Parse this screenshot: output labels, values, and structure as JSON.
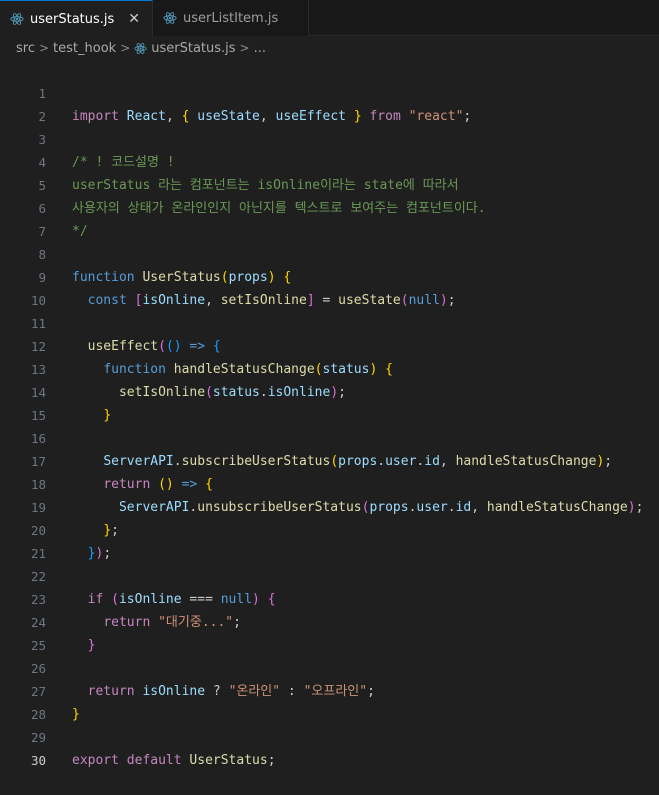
{
  "tabs": [
    {
      "label": "userStatus.js",
      "active": true
    },
    {
      "label": "userListItem.js",
      "active": false
    }
  ],
  "breadcrumb": {
    "items": [
      "src",
      "test_hook",
      "userStatus.js",
      "..."
    ]
  },
  "editor": {
    "line_numbers": [
      "1",
      "2",
      "3",
      "4",
      "5",
      "6",
      "7",
      "8",
      "9",
      "10",
      "11",
      "12",
      "13",
      "14",
      "15",
      "16",
      "17",
      "18",
      "19",
      "20",
      "21",
      "22",
      "23",
      "24",
      "25",
      "26",
      "27",
      "28",
      "29",
      "30"
    ],
    "comment_lines": [
      "/* ! 코드설명 !",
      "userStatus 라는 컴포넌트는 isOnline이라는 state에 따라서",
      "사용자의 상태가 온라인인지 아닌지를 텍스트로 보여주는 컴포넌트이다.",
      "*/"
    ],
    "strings": {
      "react": "\"react\"",
      "waiting": "\"대기중...\"",
      "online": "\"온라인\"",
      "offline": "\"오프라인\""
    }
  },
  "colors": {
    "background": "#1f1f1f",
    "tab_active_border": "#0078d4",
    "keyword": "#569cd6",
    "control": "#c586c0",
    "function": "#dcdcaa",
    "variable": "#9cdcfe",
    "string": "#ce9178",
    "comment": "#6a9955"
  },
  "icons": [
    "react-icon",
    "close-icon",
    "chevron-right-icon"
  ]
}
